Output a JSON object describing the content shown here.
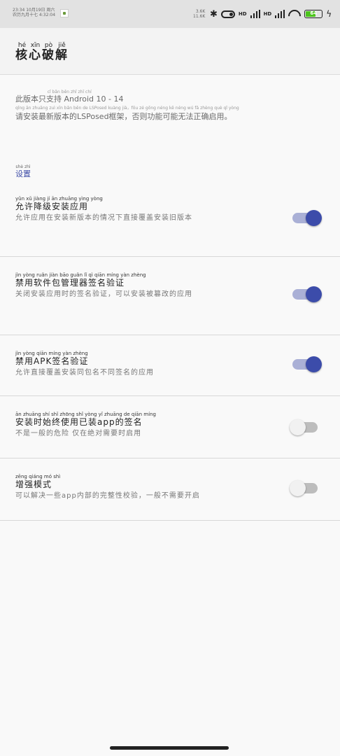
{
  "status": {
    "left_line1": "23:34 10月19日 周六",
    "left_line2": "农历九月十七 4:32:04",
    "speed_value": "3.6K",
    "speed_unit": "11.6K",
    "hd1": "HD",
    "hd2": "HD",
    "battery_level": "64",
    "battery_fraction": 0.64
  },
  "toolbar": {
    "title": [
      {
        "py": "hé",
        "hz": "核"
      },
      {
        "py": "xīn",
        "hz": "心"
      },
      {
        "py": "pò",
        "hz": "破"
      },
      {
        "py": "jiě",
        "hz": "解"
      }
    ]
  },
  "description": {
    "line1": "此版本只支持 Android 10 - 14",
    "line2": "请安装最新版本的LSPosed框架，否则功能可能无法正确启用。"
  },
  "section": {
    "title_py": "shè zhì",
    "title": "设置"
  },
  "settings": [
    {
      "title_py": "yǔn xǔ jiàng jí ān zhuāng yìng yòng",
      "title": "允许降级安装应用",
      "summary": "允许应用在安装新版本的情况下直接覆盖安装旧版本",
      "enabled": true
    },
    {
      "title_py": "jìn yòng ruǎn jiàn bāo guǎn lǐ qì qiān míng yàn zhèng",
      "title": "禁用软件包管理器签名验证",
      "summary": "关闭安装应用时的签名验证，可以安装被篡改的应用",
      "enabled": true
    },
    {
      "title_py": "jìn yòng qiān míng yàn zhèng",
      "title": "禁用APK签名验证",
      "summary": "允许直接覆盖安装同包名不同签名的应用",
      "enabled": true
    },
    {
      "title_py": "ān zhuāng shí shǐ zhōng shǐ yòng yǐ zhuāng de qiān míng",
      "title": "安装时始终使用已装app的签名",
      "summary": "不是一般的危险 仅在绝对需要时启用",
      "enabled": false
    },
    {
      "title_py": "zēng qiáng mó shì",
      "title": "增强模式",
      "summary": "可以解决一些app内部的完整性校验，一般不需要开启",
      "enabled": false
    }
  ]
}
